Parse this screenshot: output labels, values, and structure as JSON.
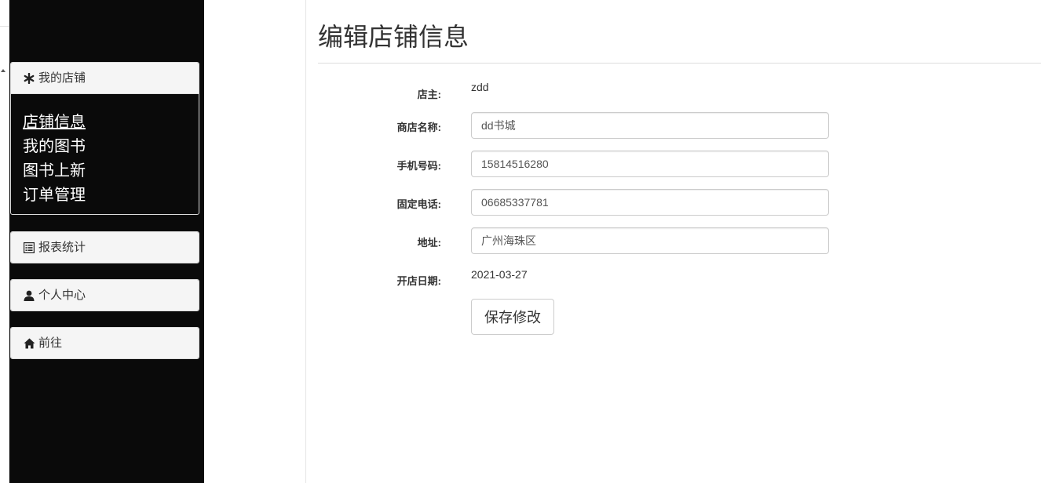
{
  "sidebar": {
    "store_panel": {
      "title": "我的店铺",
      "icon": "asterisk-icon",
      "items": [
        {
          "label": "店铺信息",
          "active": true
        },
        {
          "label": "我的图书",
          "active": false
        },
        {
          "label": "图书上新",
          "active": false
        },
        {
          "label": "订单管理",
          "active": false
        }
      ]
    },
    "reports": {
      "title": "报表统计",
      "icon": "list-alt-icon"
    },
    "profile": {
      "title": "个人中心",
      "icon": "user-icon"
    },
    "goto": {
      "title": "前往",
      "icon": "home-icon"
    }
  },
  "page": {
    "title": "编辑店铺信息"
  },
  "form": {
    "owner": {
      "label": "店主:",
      "value": "zdd"
    },
    "shop_name": {
      "label": "商店名称:",
      "value": "dd书城"
    },
    "mobile": {
      "label": "手机号码:",
      "value": "15814516280"
    },
    "landline": {
      "label": "固定电话:",
      "value": "06685337781"
    },
    "address": {
      "label": "地址:",
      "value": "广州海珠区"
    },
    "open_date": {
      "label": "开店日期:",
      "value": "2021-03-27"
    },
    "save_label": "保存修改"
  }
}
